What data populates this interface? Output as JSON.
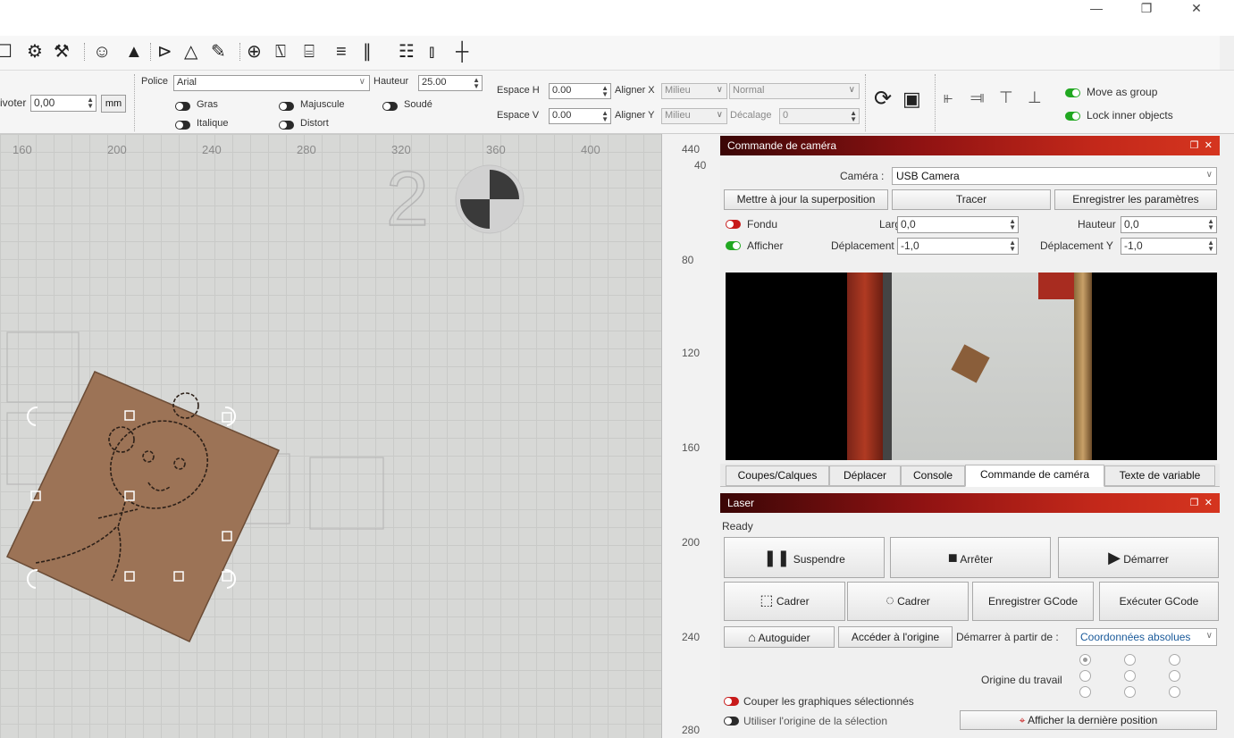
{
  "window": {
    "minimize": "—",
    "restore": "❐",
    "close": "✕"
  },
  "toolbar_icons": [
    "monitor-icon",
    "settings-icon",
    "tools-icon",
    "users-icon",
    "user-icon",
    "flip-h-icon",
    "mirror-icon",
    "pen-icon",
    "target-icon",
    "align-icon",
    "distribute-icon",
    "group-icon",
    "spacing-icon",
    "grid-icon",
    "crosshair-icon"
  ],
  "props": {
    "pivot_label": "ivoter",
    "pivot_value": "0,00",
    "unit_button": "mm",
    "font_label": "Police",
    "font_value": "Arial",
    "height_label": "Hauteur",
    "height_value": "25.00",
    "bold_label": "Gras",
    "italic_label": "Italique",
    "upper_label": "Majuscule",
    "distort_label": "Distort",
    "welded_label": "Soudé",
    "hspace_label": "Espace H",
    "hspace_value": "0.00",
    "vspace_label": "Espace V",
    "vspace_value": "0.00",
    "alignx_label": "Aligner X",
    "alignx_value": "Milieu",
    "aligny_label": "Aligner Y",
    "aligny_value": "Milieu",
    "mode_value": "Normal",
    "offset_label": "Décalage",
    "offset_value": "0",
    "move_as_group": "Move as group",
    "lock_inner": "Lock inner objects"
  },
  "ruler_top": [
    "160",
    "200",
    "240",
    "280",
    "320",
    "360",
    "400"
  ],
  "ruler_left": [
    "440",
    "40",
    "80",
    "120",
    "160",
    "200",
    "240",
    "280"
  ],
  "canvas_text": {
    "digit": "2"
  },
  "camera": {
    "title": "Commande de caméra",
    "camera_label": "Caméra :",
    "camera_value": "USB Camera",
    "btn_update": "Mettre à jour la superposition",
    "btn_trace": "Tracer",
    "btn_save": "Enregistrer les paramètres",
    "fade_label": "Fondu",
    "show_label": "Afficher",
    "width_label": "Largeur",
    "width_value": "0,0",
    "height_label": "Hauteur",
    "height_value": "0,0",
    "dx_label": "Déplacement X",
    "dx_value": "-1,0",
    "dy_label": "Déplacement Y",
    "dy_value": "-1,0"
  },
  "tabs": [
    "Coupes/Calques",
    "Déplacer",
    "Console",
    "Commande de caméra",
    "Texte de variable"
  ],
  "active_tab": "Commande de caméra",
  "laser": {
    "title": "Laser",
    "status": "Ready",
    "pause": "Suspendre",
    "stop": "Arrêter",
    "start": "Démarrer",
    "frame1": "Cadrer",
    "frame2": "Cadrer",
    "save_gcode": "Enregistrer GCode",
    "run_gcode": "Exécuter GCode",
    "home": "Autoguider",
    "goto_origin": "Accéder à l'origine",
    "start_from_label": "Démarrer à partir de :",
    "start_from_value": "Coordonnées absolues",
    "job_origin_label": "Origine du travail",
    "cut_selected": "Couper les graphiques sélectionnés",
    "use_selection_origin": "Utiliser l'origine de la sélection",
    "show_last_position": "Afficher la dernière position"
  },
  "colors": {
    "accent_red": "#c3281a",
    "toggle_green": "#21a821",
    "toggle_red": "#c81a1a",
    "wood": "#9c7356"
  }
}
